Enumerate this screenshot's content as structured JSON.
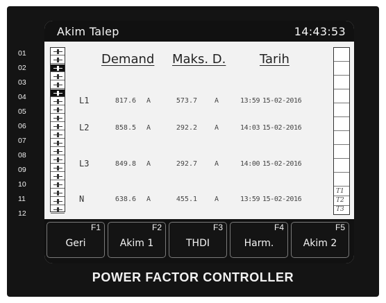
{
  "device": {
    "brand_label": "POWER FACTOR CONTROLLER"
  },
  "screen": {
    "title": "Akim Talep",
    "clock": "14:43:53"
  },
  "side_numbers": [
    "01",
    "02",
    "03",
    "04",
    "05",
    "06",
    "07",
    "08",
    "09",
    "10",
    "11",
    "12"
  ],
  "steps": [
    {
      "on": false
    },
    {
      "on": false
    },
    {
      "on": true
    },
    {
      "on": false
    },
    {
      "on": false
    },
    {
      "on": true
    },
    {
      "on": false
    },
    {
      "on": false
    },
    {
      "on": false
    },
    {
      "on": false
    },
    {
      "on": false
    },
    {
      "on": false
    },
    {
      "on": false
    },
    {
      "on": false
    },
    {
      "on": false
    },
    {
      "on": false
    },
    {
      "on": false
    },
    {
      "on": false
    },
    {
      "on": false
    },
    {
      "on": false
    }
  ],
  "table": {
    "headers": {
      "demand": "Demand",
      "max": "Maks. D.",
      "date": "Tarih"
    },
    "rows": [
      {
        "label": "L1",
        "demand": "817.6",
        "demand_unit": "A",
        "max": "573.7",
        "max_unit": "A",
        "time": "13:59",
        "date": "15-02-2016"
      },
      {
        "label": "L2",
        "demand": "858.5",
        "demand_unit": "A",
        "max": "292.2",
        "max_unit": "A",
        "time": "14:03",
        "date": "15-02-2016"
      },
      {
        "label": "L3",
        "demand": "849.8",
        "demand_unit": "A",
        "max": "292.7",
        "max_unit": "A",
        "time": "14:00",
        "date": "15-02-2016"
      },
      {
        "label": "N",
        "demand": "638.6",
        "demand_unit": "A",
        "max": "455.1",
        "max_unit": "A",
        "time": "13:59",
        "date": "15-02-2016"
      }
    ]
  },
  "right_tags": [
    "T1",
    "T2",
    "T3"
  ],
  "function_keys": [
    {
      "num": "F1",
      "label": "Geri"
    },
    {
      "num": "F2",
      "label": "Akim 1"
    },
    {
      "num": "F3",
      "label": "THDI"
    },
    {
      "num": "F4",
      "label": "Harm."
    },
    {
      "num": "F5",
      "label": "Akim 2"
    }
  ]
}
